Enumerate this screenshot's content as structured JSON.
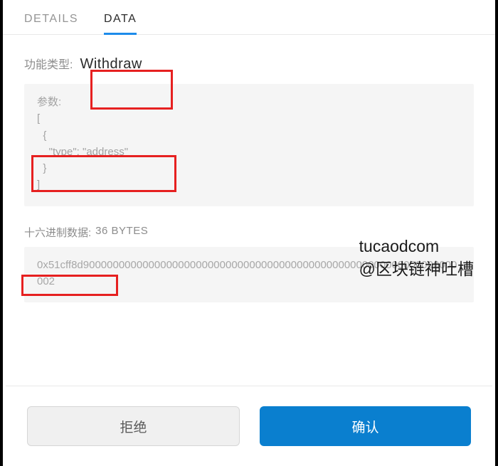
{
  "tabs": {
    "details": "DETAILS",
    "data": "DATA"
  },
  "functionType": {
    "label": "功能类型:",
    "value": "Withdraw"
  },
  "params": {
    "label": "参数:",
    "lines": {
      "l0": "[",
      "l1": "  {",
      "l2": "    \"type\": \"address\"",
      "l3": "  }",
      "l4": "]"
    }
  },
  "hex": {
    "label": "十六进制数据:",
    "size": "36 BYTES",
    "value": "0x51cff8d900000000000000000000000000000000000000000000000000000000000000002"
  },
  "buttons": {
    "reject": "拒绝",
    "confirm": "确认"
  },
  "watermark": {
    "line1": "tucaodcom",
    "line2": "@区块链神吐槽"
  }
}
